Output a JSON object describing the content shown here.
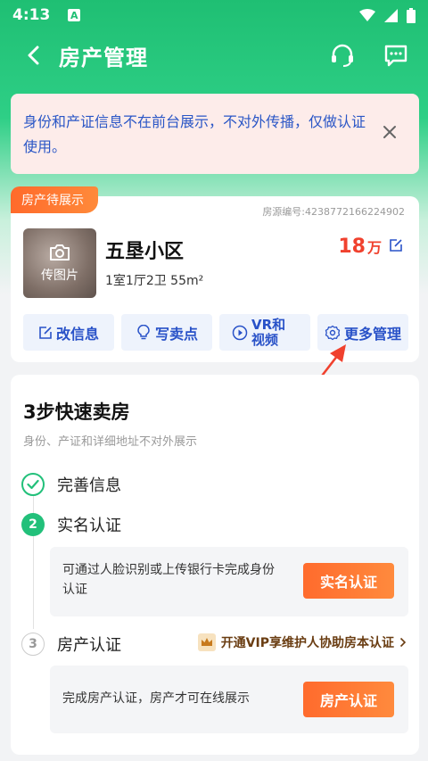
{
  "status_bar": {
    "time": "4:13",
    "a_icon": "A"
  },
  "nav": {
    "title": "房产管理"
  },
  "notice": {
    "text": "身份和产证信息不在前台展示，不对外传播，仅做认证使用。"
  },
  "property": {
    "badge": "房产待展示",
    "code": "房源编号:4238772166224902",
    "photo_label": "传图片",
    "name": "五垦小区",
    "spec": "1室1厅2卫 55m²",
    "price_num": "18",
    "price_unit": "万",
    "actions": [
      "改信息",
      "写卖点",
      "VR和视频",
      "更多管理"
    ]
  },
  "steps": {
    "title": "3步快速卖房",
    "subtitle": "身份、产证和详细地址不对外展示",
    "step1": {
      "label": "完善信息"
    },
    "step2": {
      "number": "2",
      "label": "实名认证",
      "panel_text": "可通过人脸识别或上传银行卡完成身份认证",
      "cta": "实名认证"
    },
    "step3": {
      "number": "3",
      "label": "房产认证",
      "vip_text": "开通VIP享维护人协助房本认证",
      "panel_text": "完成房产认证，房产才可在线展示",
      "cta": "房产认证"
    }
  },
  "colors": {
    "green": "#22c07a",
    "orange": "#ff6b2d",
    "blue": "#2952c8",
    "red": "#f0412e"
  }
}
